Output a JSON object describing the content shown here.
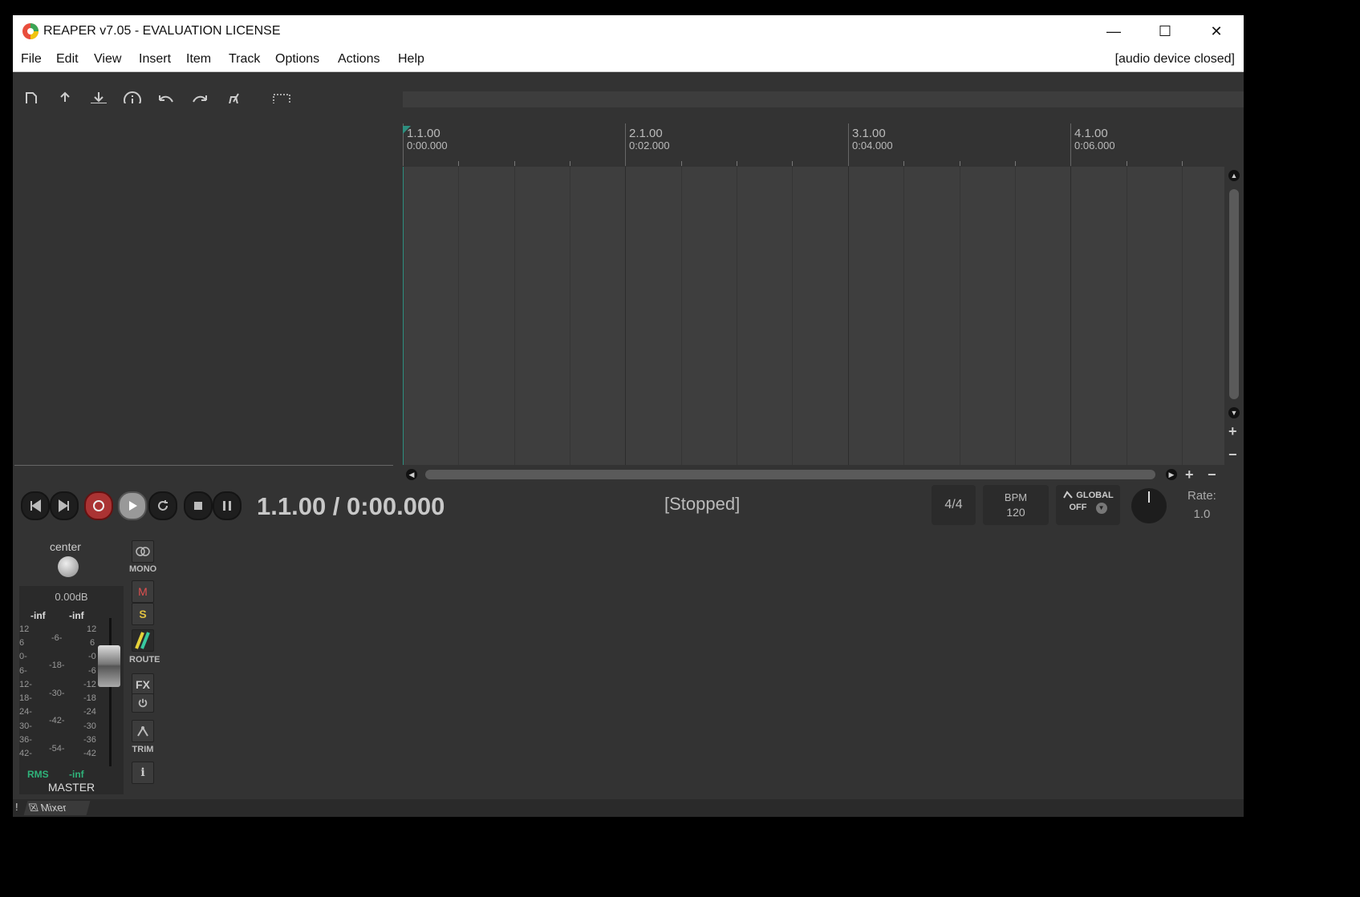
{
  "window": {
    "title": "REAPER v7.05 - EVALUATION LICENSE",
    "minimize_glyph": "—",
    "maximize_glyph": "☐",
    "close_glyph": "✕"
  },
  "menu": {
    "items": [
      "File",
      "Edit",
      "View",
      "Insert",
      "Item",
      "Track",
      "Options",
      "Actions",
      "Help"
    ],
    "audio_status": "[audio device closed]"
  },
  "toolbar": {
    "icons": [
      "new-project-icon",
      "open-project-icon",
      "save-project-icon",
      "project-info-icon",
      "undo-icon",
      "redo-icon",
      "metronome-icon",
      "marquee-select-icon",
      "ripple-edit-icon",
      "grouping-icon",
      "snap-grid-icon",
      "trim-behind-icon",
      "grid-lines-icon",
      "loop-points-icon",
      "lock-icon",
      "razor-edit-icon"
    ],
    "accent": "#1f5a4f"
  },
  "ruler": {
    "markers": [
      {
        "bar": "1.1.00",
        "time": "0:00.000"
      },
      {
        "bar": "2.1.00",
        "time": "0:02.000"
      },
      {
        "bar": "3.1.00",
        "time": "0:04.000"
      },
      {
        "bar": "4.1.00",
        "time": "0:06.000"
      }
    ]
  },
  "transport": {
    "position": "1.1.00 / 0:00.000",
    "status": "[Stopped]",
    "time_signature": "4/4",
    "bpm_label": "BPM",
    "bpm_value": "120",
    "global_label": "GLOBAL",
    "global_value": "OFF",
    "rate_label": "Rate:",
    "rate_value": "1.0",
    "record_color": "#c0392b"
  },
  "mixer": {
    "pan_label": "center",
    "volume": "0.00dB",
    "peak_left": "-inf",
    "peak_right": "-inf",
    "scale_left": [
      "12",
      "6",
      "0-",
      "6-",
      "12-",
      "18-",
      "24-",
      "30-",
      "36-",
      "42-"
    ],
    "scale_mid": [
      "-6-",
      "-18-",
      "-30-",
      "-42-",
      "-54-"
    ],
    "scale_right": [
      "12",
      "6",
      "-0",
      "-6",
      "-12",
      "-18",
      "-24",
      "-30",
      "-36",
      "-42"
    ],
    "rms_label": "RMS",
    "rms_value": "-inf",
    "track_name": "MASTER",
    "buttons": {
      "mono": "MONO",
      "mute": "M",
      "solo": "S",
      "route": "ROUTE",
      "fx": "FX",
      "trim": "TRIM",
      "info": "i"
    }
  },
  "bottom": {
    "exclaim": "!",
    "tab_label": "Mixer",
    "tab_close": "☒"
  }
}
